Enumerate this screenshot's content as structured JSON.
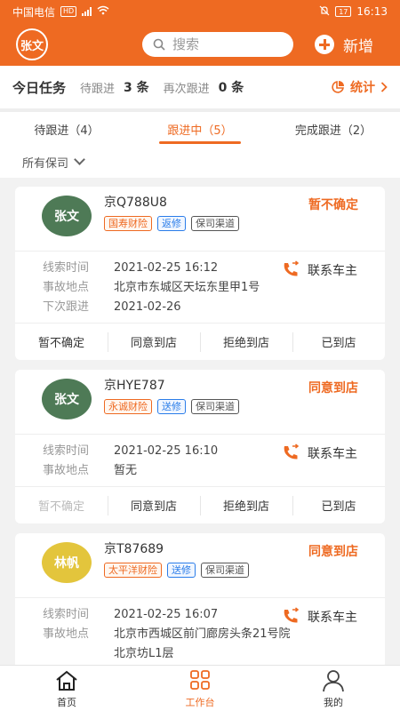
{
  "statusbar": {
    "carrier": "中国电信",
    "hd": "HD",
    "battery": "17",
    "time": "16:13"
  },
  "header": {
    "avatar": "张文",
    "search_placeholder": "搜索",
    "add_label": "新增"
  },
  "summary": {
    "title": "今日任务",
    "pending_label": "待跟进",
    "pending_count": "3 条",
    "again_label": "再次跟进",
    "again_count": "0 条",
    "stats_label": "统计"
  },
  "tabs": [
    {
      "label": "待跟进（4）"
    },
    {
      "label": "跟进中（5）"
    },
    {
      "label": "完成跟进（2）"
    }
  ],
  "filter": {
    "label": "所有保司"
  },
  "cards": [
    {
      "avatar": "张文",
      "avatar_color": "#4e7a56",
      "plate": "京Q788U8",
      "tags": [
        "国寿财险",
        "返修",
        "保司渠道"
      ],
      "status": "暂不确定",
      "rows": [
        {
          "k": "线索时间",
          "v": "2021-02-25 16:12"
        },
        {
          "k": "事故地点",
          "v": "北京市东城区天坛东里甲1号"
        },
        {
          "k": "下次跟进",
          "v": "2021-02-26"
        }
      ],
      "contact": "联系车主",
      "actions": [
        "暂不确定",
        "同意到店",
        "拒绝到店",
        "已到店"
      ]
    },
    {
      "avatar": "张文",
      "avatar_color": "#4e7a56",
      "plate": "京HYE787",
      "tags": [
        "永诚财险",
        "送修",
        "保司渠道"
      ],
      "status": "同意到店",
      "rows": [
        {
          "k": "线索时间",
          "v": "2021-02-25 16:10"
        },
        {
          "k": "事故地点",
          "v": "暂无"
        }
      ],
      "contact": "联系车主",
      "actions": [
        "暂不确定",
        "同意到店",
        "拒绝到店",
        "已到店"
      ]
    },
    {
      "avatar": "林帆",
      "avatar_color": "#e3c53c",
      "plate": "京T87689",
      "tags": [
        "太平洋财险",
        "送修",
        "保司渠道"
      ],
      "status": "同意到店",
      "rows": [
        {
          "k": "线索时间",
          "v": "2021-02-25 16:07"
        },
        {
          "k": "事故地点",
          "v": "北京市西城区前门廊房头条21号院北京坊L1层"
        }
      ],
      "contact": "联系车主"
    }
  ],
  "tabbar": [
    {
      "label": "首页",
      "icon": "home-icon"
    },
    {
      "label": "工作台",
      "icon": "grid-icon"
    },
    {
      "label": "我的",
      "icon": "user-icon"
    }
  ],
  "colors": {
    "accent": "#ee6a22",
    "tag_blue": "#2b7de9"
  }
}
